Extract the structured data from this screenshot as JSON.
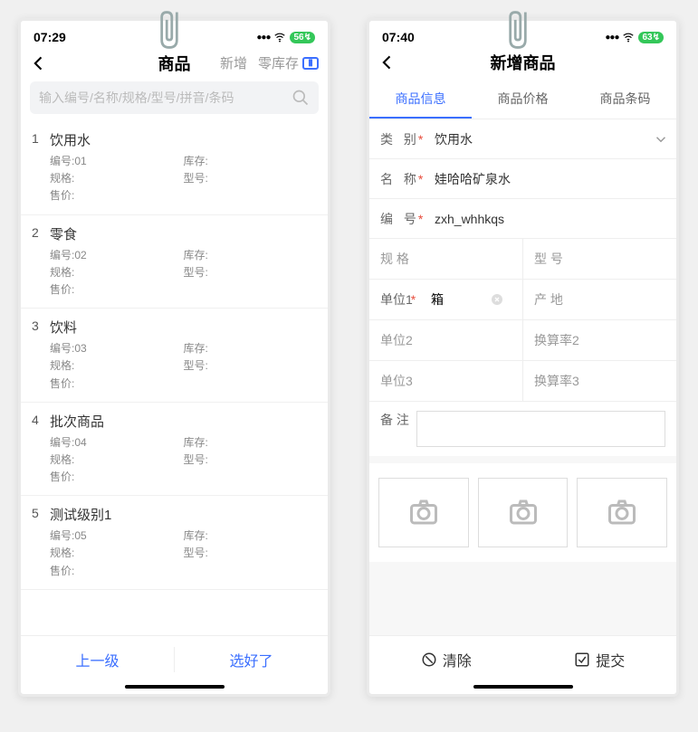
{
  "left": {
    "status": {
      "time": "07:29",
      "battery": "56"
    },
    "nav": {
      "title": "商品",
      "add": "新增",
      "zero_stock": "零库存"
    },
    "search": {
      "placeholder": "输入编号/名称/规格/型号/拼音/条码"
    },
    "labels": {
      "code": "编号:",
      "stock": "库存:",
      "spec": "规格:",
      "model": "型号:",
      "price": "售价:"
    },
    "items": [
      {
        "idx": "1",
        "name": "饮用水",
        "code": "01"
      },
      {
        "idx": "2",
        "name": "零食",
        "code": "02"
      },
      {
        "idx": "3",
        "name": "饮料",
        "code": "03"
      },
      {
        "idx": "4",
        "name": "批次商品",
        "code": "04"
      },
      {
        "idx": "5",
        "name": "测试级别1",
        "code": "05"
      }
    ],
    "bottom": {
      "prev": "上一级",
      "done": "选好了"
    }
  },
  "right": {
    "status": {
      "time": "07:40",
      "battery": "63"
    },
    "nav": {
      "title": "新增商品"
    },
    "tabs": [
      "商品信息",
      "商品价格",
      "商品条码"
    ],
    "form": {
      "category_label": "类  别",
      "category_value": "饮用水",
      "name_label": "名  称",
      "name_value": "娃哈哈矿泉水",
      "code_label": "编  号",
      "code_value": "zxh_whhkqs",
      "spec_label": "规  格",
      "model_label": "型  号",
      "unit1_label": "单位1",
      "unit1_value": "箱",
      "origin_label": "产  地",
      "unit2_label": "单位2",
      "rate2_label": "换算率2",
      "unit3_label": "单位3",
      "rate3_label": "换算率3",
      "remark_label": "备  注"
    },
    "bottom": {
      "clear": "清除",
      "submit": "提交"
    }
  }
}
